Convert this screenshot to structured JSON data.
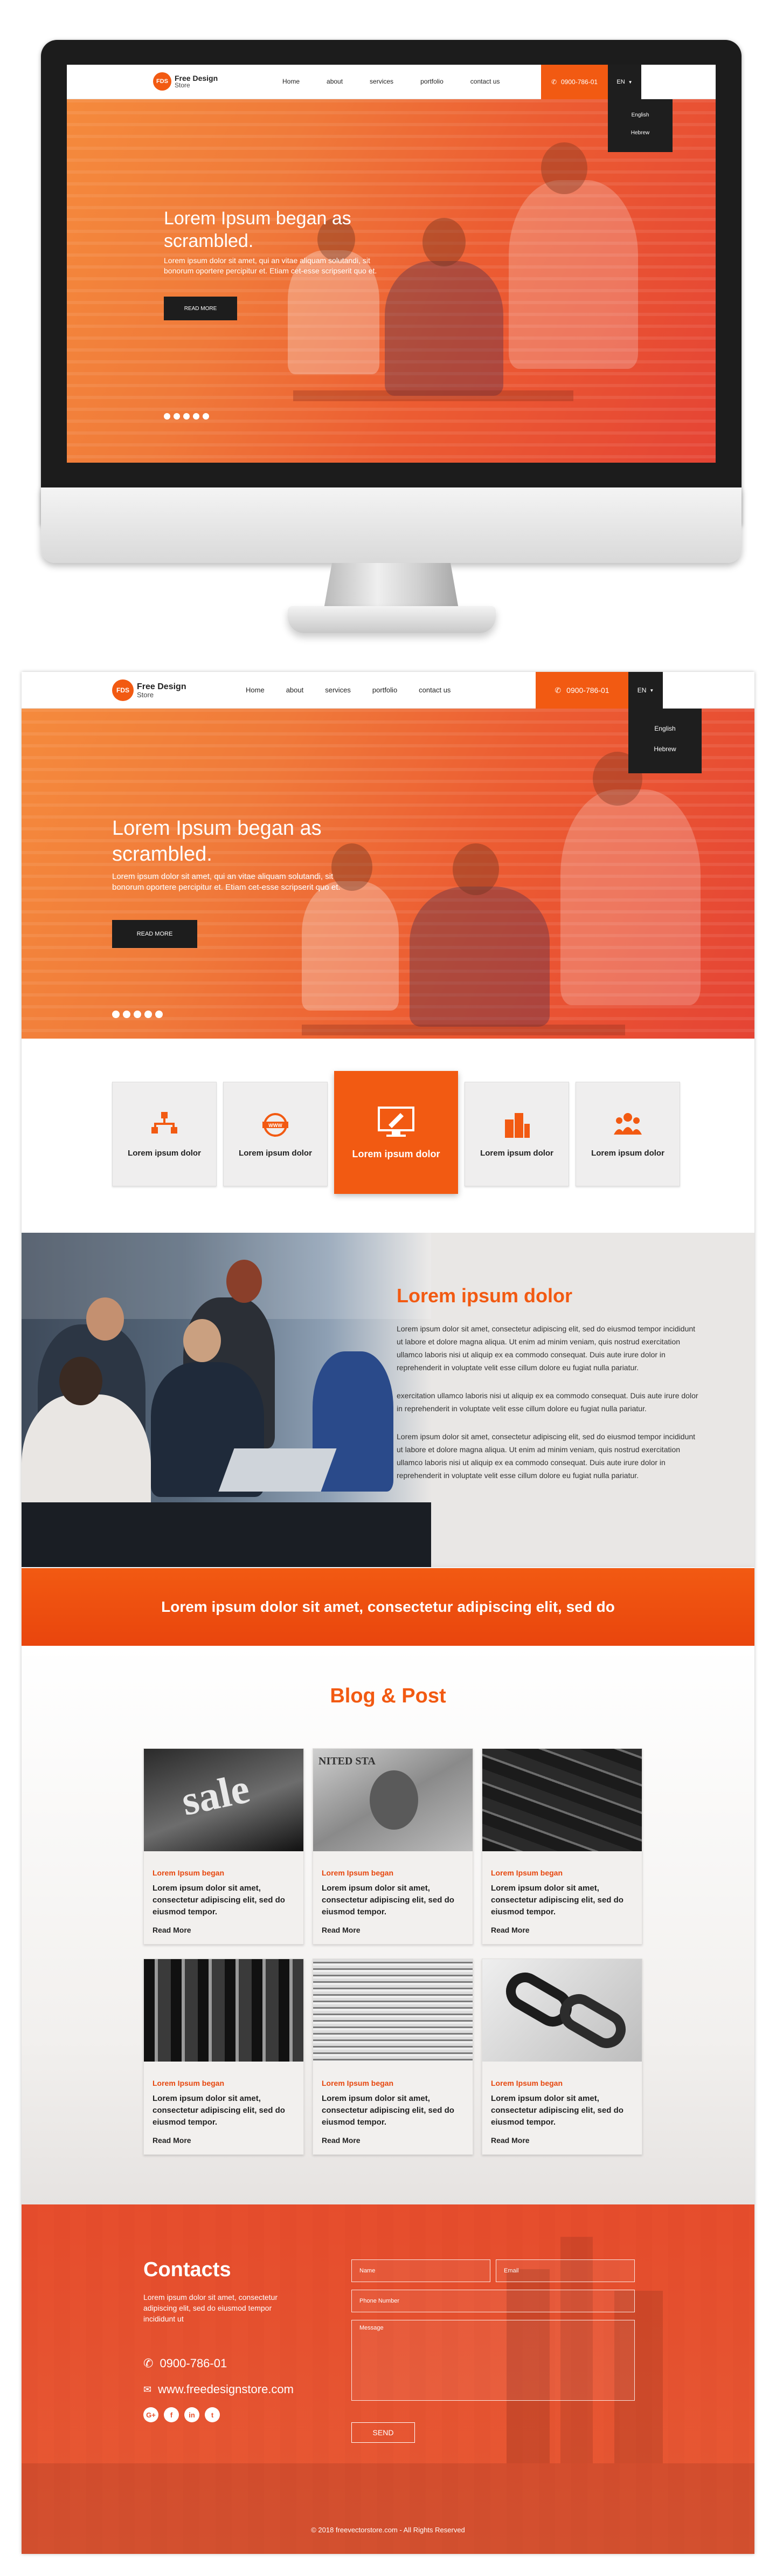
{
  "brand": {
    "logo_badge": "FDS",
    "name_line1": "Free Design",
    "name_line2": "Store",
    "accent_color": "#f25a12"
  },
  "nav": {
    "items": [
      "Home",
      "about",
      "services",
      "portfolio",
      "contact us"
    ]
  },
  "header": {
    "phone": "0900-786-01",
    "lang": "EN",
    "lang_options": [
      "English",
      "Hebrew"
    ]
  },
  "hero": {
    "title": "Lorem Ipsum began as scrambled.",
    "text": "Lorem ipsum dolor sit amet, qui an vitae aliquam solutandi, sit bonorum oportere percipitur et. Etiam cet-esse scripserit quo et.",
    "button": "Read More",
    "slide_count": 5
  },
  "features": [
    "Lorem ipsum dolor",
    "Lorem ipsum dolor",
    "Lorem ipsum dolor",
    "Lorem ipsum dolor",
    "Lorem ipsum dolor"
  ],
  "about": {
    "title": "Lorem ipsum dolor",
    "paragraph1": "Lorem ipsum dolor sit amet, consectetur adipiscing elit, sed do eiusmod tempor incididunt ut labore et dolore magna aliqua. Ut enim ad minim veniam, quis nostrud exercitation ullamco laboris nisi ut aliquip ex ea commodo consequat. Duis aute irure dolor in reprehenderit in voluptate velit esse cillum dolore eu fugiat nulla pariatur.",
    "paragraph2": "exercitation ullamco laboris nisi ut aliquip ex ea commodo consequat. Duis aute irure dolor in reprehenderit in voluptate velit esse cillum dolore eu fugiat nulla pariatur.",
    "paragraph3": "Lorem ipsum dolor sit amet, consectetur adipiscing elit, sed do eiusmod tempor incididunt ut labore et dolore magna aliqua. Ut enim ad minim veniam, quis nostrud exercitation ullamco laboris nisi ut aliquip ex ea commodo consequat. Duis aute irure dolor in reprehenderit in voluptate velit esse cillum dolore eu fugiat nulla pariatur."
  },
  "cta": {
    "text": "Lorem ipsum dolor sit amet, consectetur adipiscing elit, sed do"
  },
  "blog": {
    "heading": "Blog & Post",
    "post_title": "Lorem Ipsum began",
    "post_text": "Lorem ipsum dolor sit amet, consectetur adipiscing elit, sed do eiusmod tempor.",
    "read_more": "Read More",
    "image_icons": [
      "sale-sign-photo",
      "dollar-bill-photo",
      "keyboard-photo",
      "escalator-photo",
      "coins-stack-photo",
      "chain-link-photo"
    ]
  },
  "footer": {
    "heading": "Contacts",
    "intro": "Lorem ipsum dolor sit amet, consectetur adipiscing elit, sed do eiusmod tempor incididunt ut",
    "phone": "0900-786-01",
    "website": "www.freedesignstore.com",
    "form": {
      "name": "Name",
      "email": "Email",
      "phone_number": "Phone Number",
      "message": "Message",
      "send": "Send"
    },
    "social_icons": [
      "google-plus-icon",
      "facebook-icon",
      "linkedin-icon",
      "twitter-icon"
    ],
    "copyright": "© 2018 freevectorstore.com - All Rights Reserved"
  }
}
